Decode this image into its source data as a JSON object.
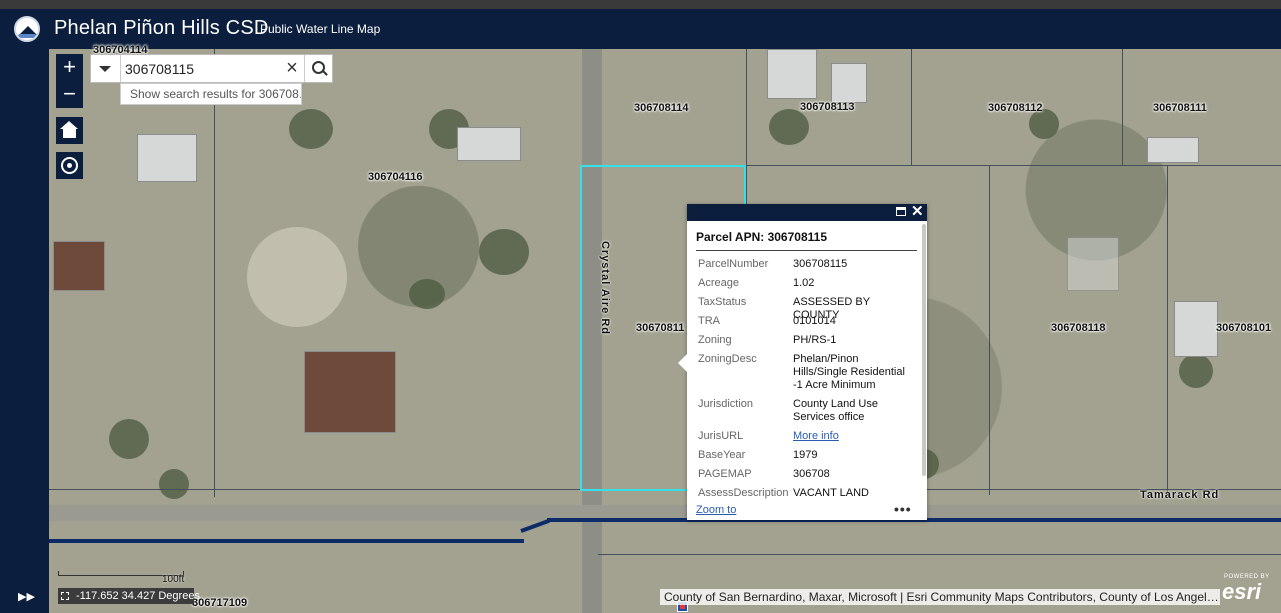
{
  "app": {
    "title": "Phelan Piñon Hills CSD",
    "subtitle": "Public Water Line Map"
  },
  "search": {
    "value": "306708115",
    "suggestion": "Show search results for 306708…"
  },
  "map": {
    "parcel_labels": [
      "306708114",
      "306708113",
      "306708112",
      "306708111",
      "306704116",
      "30670811",
      "306708118",
      "306708101",
      "306717109",
      "306704114"
    ],
    "streets": [
      "Crystal Aire Rd",
      "Tamarack Rd"
    ],
    "scale_label": "100ft",
    "coordinates": "-117.652 34.427 Degrees",
    "attribution": "County of San Bernardino, Maxar, Microsoft | Esri Community Maps Contributors, County of Los Angel…",
    "esri_powered": "POWERED BY",
    "esri_word": "esri"
  },
  "popup": {
    "title": "Parcel APN: 306708115",
    "fields": [
      {
        "key": "ParcelNumber",
        "value": "306708115"
      },
      {
        "key": "Acreage",
        "value": "1.02"
      },
      {
        "key": "TaxStatus",
        "value": "ASSESSED BY COUNTY"
      },
      {
        "key": "TRA",
        "value": "0101014"
      },
      {
        "key": "Zoning",
        "value": "PH/RS-1"
      },
      {
        "key": "ZoningDesc",
        "value": "Phelan/Pinon Hills/Single Residential -1 Acre Minimum"
      },
      {
        "key": "Jurisdiction",
        "value": "County Land Use Services office"
      },
      {
        "key": "JurisURL",
        "value": "More info"
      },
      {
        "key": "BaseYear",
        "value": "1979"
      },
      {
        "key": "PAGEMAP",
        "value": "306708"
      },
      {
        "key": "AssessDescription",
        "value": "VACANT LAND"
      }
    ],
    "zoom_to": "Zoom to",
    "more": "•••"
  },
  "colors": {
    "header_bg": "#0b1e3d",
    "selected_parcel": "#35e0e8",
    "water_line": "#0d2b66",
    "link": "#2a5db0"
  },
  "icons": [
    "logo-icon",
    "zoom-in-icon",
    "zoom-out-icon",
    "home-icon",
    "locate-icon",
    "chevron-down-icon",
    "close-icon",
    "search-icon",
    "maximize-icon",
    "expand-icon"
  ]
}
